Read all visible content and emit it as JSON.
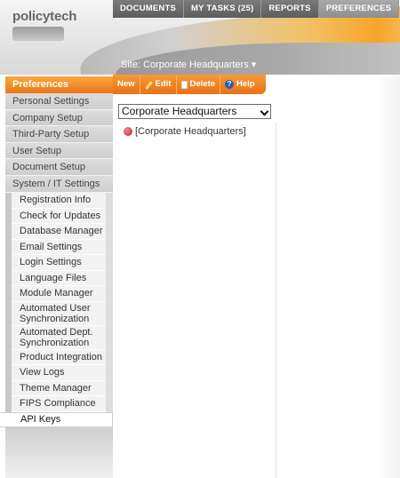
{
  "app": {
    "logo": "policytech"
  },
  "topnav": {
    "tabs": [
      {
        "label": "DOCUMENTS"
      },
      {
        "label": "MY TASKS (25)"
      },
      {
        "label": "REPORTS"
      },
      {
        "label": "PREFERENCES"
      }
    ],
    "active_tab": "PREFERENCES"
  },
  "site": {
    "label": "Site:",
    "value": "Corporate Headquarters"
  },
  "sidebar": {
    "header": "Preferences",
    "items": [
      {
        "label": "Personal Settings"
      },
      {
        "label": "Company Setup"
      },
      {
        "label": "Third-Party Setup"
      },
      {
        "label": "User Setup"
      },
      {
        "label": "Document Setup"
      },
      {
        "label": "System / IT Settings"
      }
    ],
    "subitems": [
      {
        "label": "Registration Info"
      },
      {
        "label": "Check for Updates"
      },
      {
        "label": "Database Manager"
      },
      {
        "label": "Email Settings"
      },
      {
        "label": "Login Settings"
      },
      {
        "label": "Language Files"
      },
      {
        "label": "Module Manager"
      },
      {
        "label": "Automated User Synchronization"
      },
      {
        "label": "Automated Dept. Synchronization"
      },
      {
        "label": "Product Integration"
      },
      {
        "label": "View Logs"
      },
      {
        "label": "Theme Manager"
      },
      {
        "label": "FIPS Compliance"
      }
    ],
    "selected": "API Keys"
  },
  "toolbar": {
    "new_label": "New",
    "edit_label": "Edit",
    "delete_label": "Delete",
    "help_label": "Help"
  },
  "main": {
    "site_select_value": "Corporate Headquarters",
    "tree_item": "[Corporate Headquarters]"
  },
  "colors": {
    "accent_orange": "#f08a2a",
    "nav_gray": "#6b6b6b"
  }
}
